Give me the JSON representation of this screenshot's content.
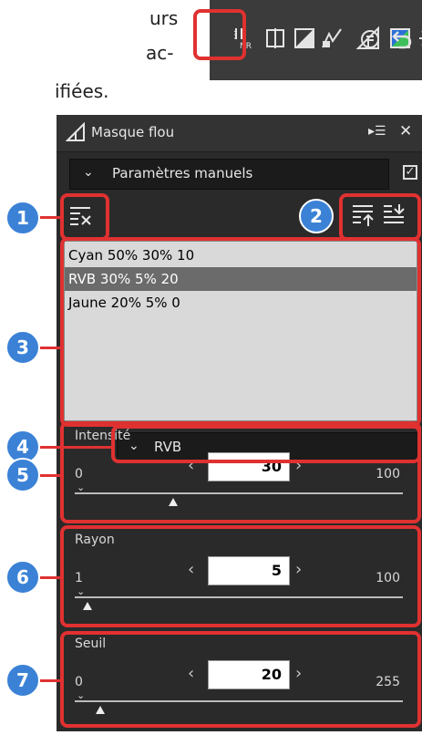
{
  "doc": {
    "line1": "urs",
    "line2": "ac-",
    "line3": "ifiées."
  },
  "toolbar": {
    "icons": [
      "noise-reduction-icon",
      "crop-icon",
      "levels-icon",
      "curves-icon",
      "unsharp-mask-icon",
      "color-icon",
      "star-filter-icon",
      "reset-icon",
      "undo-icon"
    ]
  },
  "palette": {
    "title": "Masque flou",
    "menu_glyph": "▸☰",
    "close_glyph": "✕",
    "preset": "Paramètres manuels",
    "checkbox_glyph": "✓",
    "list_items": [
      "Cyan 50% 30% 10",
      "RVB 30% 5% 20",
      "Jaune 20% 5% 0"
    ],
    "selected_index": 1,
    "channel": "RVB",
    "sliders": [
      {
        "label": "Intensité",
        "min": "0",
        "max": "100",
        "value": "30",
        "fraction": 0.3
      },
      {
        "label": "Rayon",
        "min": "1",
        "max": "100",
        "value": "5",
        "fraction": 0.04
      },
      {
        "label": "Seuil",
        "min": "0",
        "max": "255",
        "value": "20",
        "fraction": 0.078
      }
    ]
  },
  "callouts": [
    "1",
    "2",
    "3",
    "4",
    "5",
    "6",
    "7"
  ]
}
